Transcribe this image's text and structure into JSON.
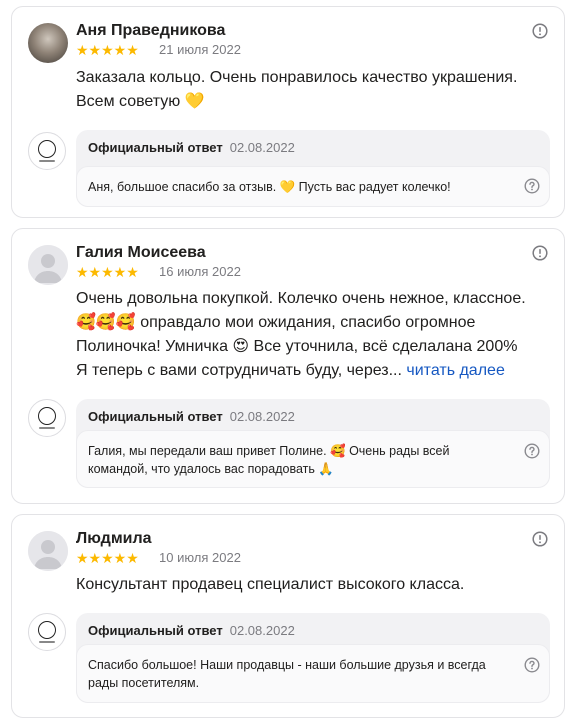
{
  "reviews": [
    {
      "author": "Аня Праведникова",
      "stars": "★★★★★",
      "rating": 5,
      "date": "21 июля 2022",
      "text_lines": [
        "Заказала кольцо. Очень понравилось качество украшения.",
        "Всем советую 💛"
      ],
      "reply": {
        "label": "Официальный ответ",
        "date": "02.08.2022",
        "text_lines": [
          "Аня, большое спасибо за отзыв. 💛 Пусть вас радует колечко!"
        ]
      }
    },
    {
      "author": "Галия Моисеева",
      "stars": "★★★★★",
      "rating": 5,
      "date": "16 июля 2022",
      "text_lines": [
        "Очень довольна покупкой. Колечко очень нежное, классное.",
        "🥰🥰🥰 оправдало мои ожидания, спасибо огромное",
        "Полиночка! Умничка 😍 Все уточнила, всё сделалана 200%",
        "Я теперь с вами сотрудничать буду, через..."
      ],
      "read_more": "читать далее",
      "reply": {
        "label": "Официальный ответ",
        "date": "02.08.2022",
        "text_lines": [
          "Галия, мы передали ваш привет Полине. 🥰 Очень рады всей",
          "командой, что удалось вас порадовать 🙏"
        ]
      }
    },
    {
      "author": "Людмила",
      "stars": "★★★★★",
      "rating": 5,
      "date": "10 июля 2022",
      "text_lines": [
        "Консультант продавец специалист высокого класса."
      ],
      "reply": {
        "label": "Официальный ответ",
        "date": "02.08.2022",
        "text_lines": [
          "Спасибо большое! Наши продавцы - наши большие друзья и всегда",
          "рады посетителям."
        ]
      }
    }
  ],
  "icons": {
    "info": "info-icon",
    "question": "question-icon",
    "avatar_default": "user-avatar-icon",
    "org_logo": "org-logo-icon"
  },
  "colors": {
    "star": "#fcb900",
    "link": "#1658c2",
    "muted": "#7b7b80",
    "reply_bg": "#f2f2f4"
  }
}
